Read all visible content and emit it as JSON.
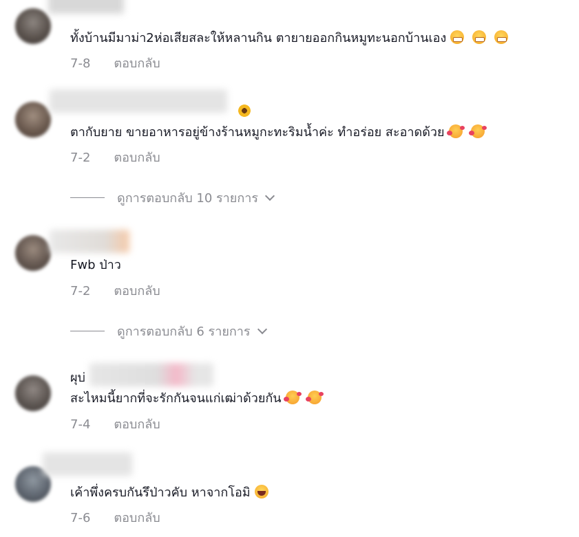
{
  "comments": [
    {
      "text": "ทั้งบ้านมีมาม่า2ห่อเสียสละให้หลานกิน ตายายออกกินหมูทะนอกบ้านเอง",
      "date": "7-8",
      "reply": "ตอบกลับ",
      "emojis": [
        "grin",
        "grin",
        "grin"
      ]
    },
    {
      "text": "ตากับยาย ขายอาหารอยู่ข้างร้านหมูกะทะริมน้ำค่ะ ทำอร่อย สะอาดด้วย",
      "date": "7-2",
      "reply": "ตอบกลับ",
      "emojis": [
        "hug",
        "hug"
      ],
      "view_replies": "ดูการตอบกลับ 10 รายการ"
    },
    {
      "text": "Fwb ป่าว",
      "date": "7-2",
      "reply": "ตอบกลับ",
      "view_replies": "ดูการตอบกลับ 6 รายการ"
    },
    {
      "prefix": "ผุบ่",
      "text": "สะไหมนี้ยากที่จะรักกันจนแก่เฒ่าด้วยกัน",
      "date": "7-4",
      "reply": "ตอบกลับ",
      "emojis": [
        "hug",
        "hug"
      ]
    },
    {
      "text": "เค้าพึ่งครบกันรึป่าวคับ หาจากโอมิ",
      "date": "7-6",
      "reply": "ตอบกลับ",
      "emojis": [
        "laugh"
      ]
    }
  ],
  "icons": {
    "chevron": "chevron-down-icon",
    "flower": "sunflower-emoji-icon"
  }
}
